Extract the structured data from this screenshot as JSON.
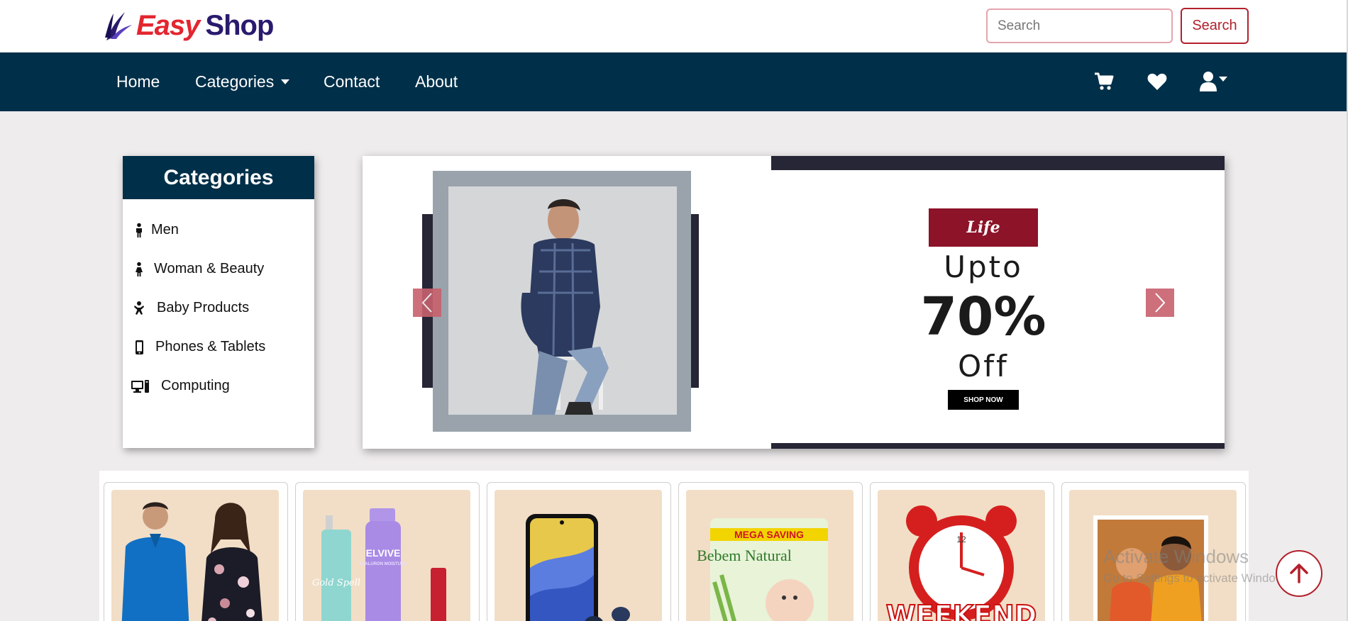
{
  "brand": {
    "name_part1": "Easy",
    "name_part2": "Shop"
  },
  "search": {
    "placeholder": "Search",
    "button_label": "Search"
  },
  "nav": {
    "items": [
      {
        "label": "Home"
      },
      {
        "label": "Categories",
        "dropdown": true
      },
      {
        "label": "Contact"
      },
      {
        "label": "About"
      }
    ],
    "icons": [
      "cart-icon",
      "heart-icon",
      "user-icon"
    ]
  },
  "sidebar": {
    "title": "Categories",
    "items": [
      {
        "label": "Men",
        "icon": "male-icon"
      },
      {
        "label": "Woman & Beauty",
        "icon": "female-icon"
      },
      {
        "label": "Baby Products",
        "icon": "baby-icon"
      },
      {
        "label": "Phones & Tablets",
        "icon": "phone-icon"
      },
      {
        "label": "Computing",
        "icon": "computer-icon"
      }
    ]
  },
  "banner": {
    "badge": "Life",
    "line1": "Upto",
    "line2": "70%",
    "line3": "Off",
    "cta": "SHOP NOW"
  },
  "products": [
    {
      "image": "men-and-woman-fashion"
    },
    {
      "image": "beauty-products",
      "text": "ELVIVE",
      "subtext": "HYALURON MOISTURE",
      "bottle_text": "Gold Spell"
    },
    {
      "image": "smartphone-and-earbuds"
    },
    {
      "image": "baby-diapers",
      "banner": "MEGA SAVING",
      "brand": "Bebem Natural"
    },
    {
      "image": "weekend-deals-clock",
      "text": "WEEKEND"
    },
    {
      "image": "baby-with-parent"
    }
  ],
  "os_watermark": {
    "title": "Activate Windows",
    "subtitle": "Go to Settings to activate Windows."
  },
  "colors": {
    "navy": "#002f49",
    "brand_red": "#e3262f",
    "accent_red": "#b2202c",
    "card_bg": "#f2dec6",
    "page_bg": "#efeced"
  }
}
